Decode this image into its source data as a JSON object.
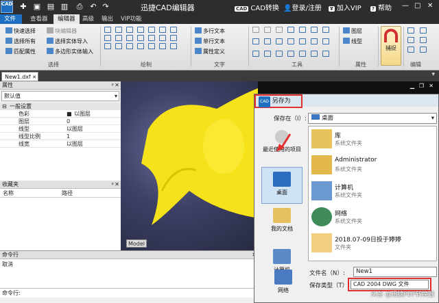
{
  "titlebar": {
    "logo": "CAD",
    "title": "迅捷CAD编辑器",
    "cad_convert": "CAD转换",
    "login": "登录/注册",
    "vip": "加入VIP",
    "help": "帮助"
  },
  "menu": {
    "file": "文件",
    "items": [
      "查看器",
      "编辑器",
      "高级",
      "输出",
      "VIP功能"
    ]
  },
  "ribbon": {
    "select": {
      "quick": "快速选择",
      "all": "选择所有",
      "match": "匹配属性",
      "label": "选择"
    },
    "block": {
      "edit": "块编辑器",
      "import": "选择实体导入",
      "poly": "多边形实体输入"
    },
    "draw_label": "绘制",
    "text": {
      "multi": "多行文本",
      "single": "单行文本",
      "attr": "属性定义",
      "label": "文字"
    },
    "tools_label": "工具",
    "layers": {
      "layer": "图层",
      "linetype": "线型",
      "label": "属性"
    },
    "snap": "捕捉",
    "edit_label": "编辑"
  },
  "doc_tab": "New1.dxf",
  "properties": {
    "header": "属性",
    "dropdown": "默认值",
    "section": "一般设置",
    "rows": [
      {
        "key": "色彩",
        "value": "以图层"
      },
      {
        "key": "图层",
        "value": "0"
      },
      {
        "key": "线型",
        "value": "以图层"
      },
      {
        "key": "线型比例",
        "value": "1"
      },
      {
        "key": "线宽",
        "value": "以图层"
      }
    ]
  },
  "favorites": {
    "header": "收藏夹",
    "col_name": "名称",
    "col_path": "路径"
  },
  "canvas": {
    "model_tab": "Model"
  },
  "command": {
    "header": "命令行",
    "output": "取消",
    "prompt": "命令行:"
  },
  "dialog": {
    "title": "另存为",
    "save_in_label": "保存在（I）:",
    "save_in_value": "桌面",
    "places": [
      "最近使用的项目",
      "桌面",
      "我的文档",
      "计算机",
      "网络"
    ],
    "files": [
      {
        "name": "库",
        "sub": "系统文件夹"
      },
      {
        "name": "Administrator",
        "sub": "系统文件夹"
      },
      {
        "name": "计算机",
        "sub": "系统文件夹"
      },
      {
        "name": "网络",
        "sub": "系统文件夹"
      },
      {
        "name": "2018.07-09日投于婷婷",
        "sub": "文件夹"
      }
    ],
    "filename_label": "文件名（N）:",
    "filename_value": "New1",
    "filetype_label": "保存类型（T）:",
    "filetype_value": "CAD 2004 DWG 文件"
  },
  "watermark": "头条 @迅捷PDF转换器"
}
